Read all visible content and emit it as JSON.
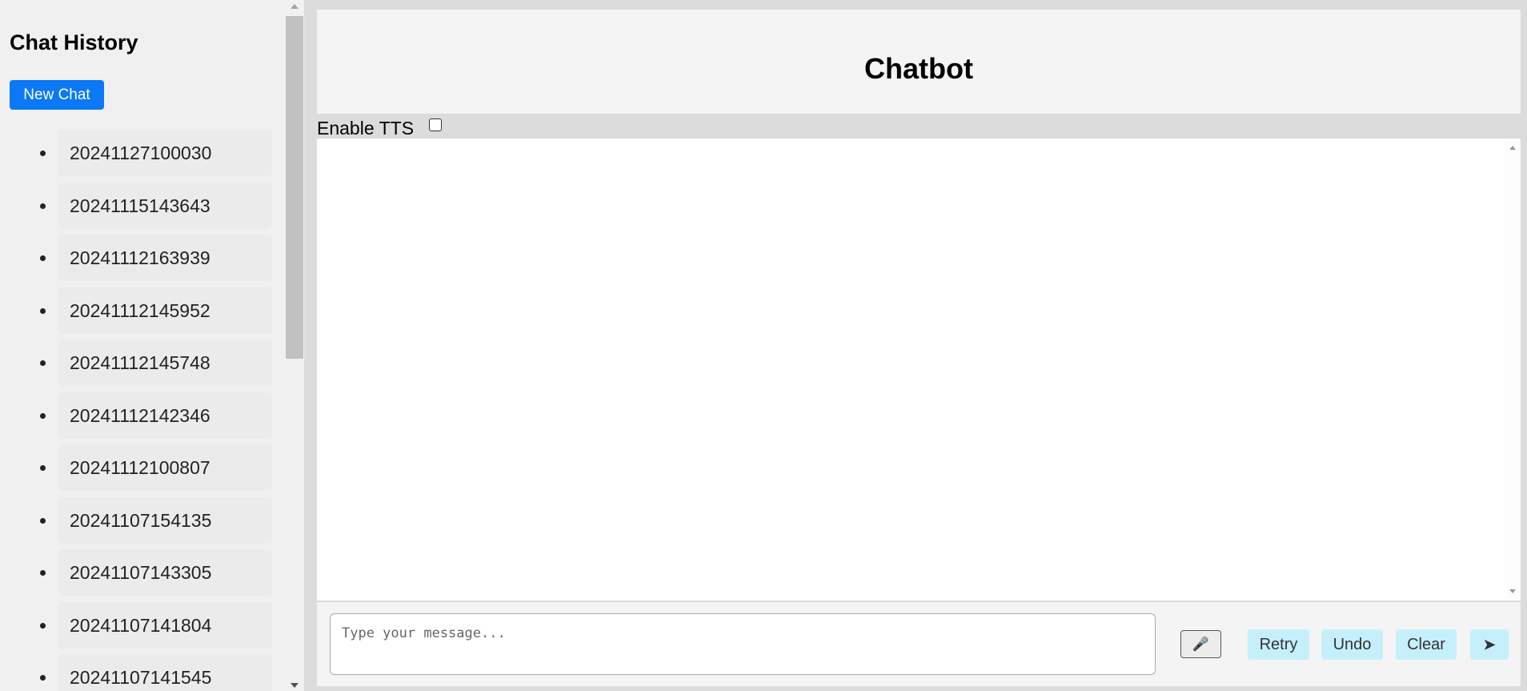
{
  "sidebar": {
    "title": "Chat History",
    "new_chat_label": "New Chat",
    "items": [
      {
        "label": "20241127100030"
      },
      {
        "label": "20241115143643"
      },
      {
        "label": "20241112163939"
      },
      {
        "label": "20241112145952"
      },
      {
        "label": "20241112145748"
      },
      {
        "label": "20241112142346"
      },
      {
        "label": "20241112100807"
      },
      {
        "label": "20241107154135"
      },
      {
        "label": "20241107143305"
      },
      {
        "label": "20241107141804"
      },
      {
        "label": "20241107141545"
      }
    ]
  },
  "header": {
    "title": "Chatbot"
  },
  "tts": {
    "label": "Enable TTS",
    "checked": false
  },
  "input": {
    "placeholder": "Type your message...",
    "value": ""
  },
  "controls": {
    "mic_icon": "microphone-icon",
    "retry_label": "Retry",
    "undo_label": "Undo",
    "clear_label": "Clear",
    "send_label": "➤"
  },
  "colors": {
    "primary_button": "#0b78f5",
    "action_button": "#c5f0fb",
    "background": "#dcdcdc"
  }
}
